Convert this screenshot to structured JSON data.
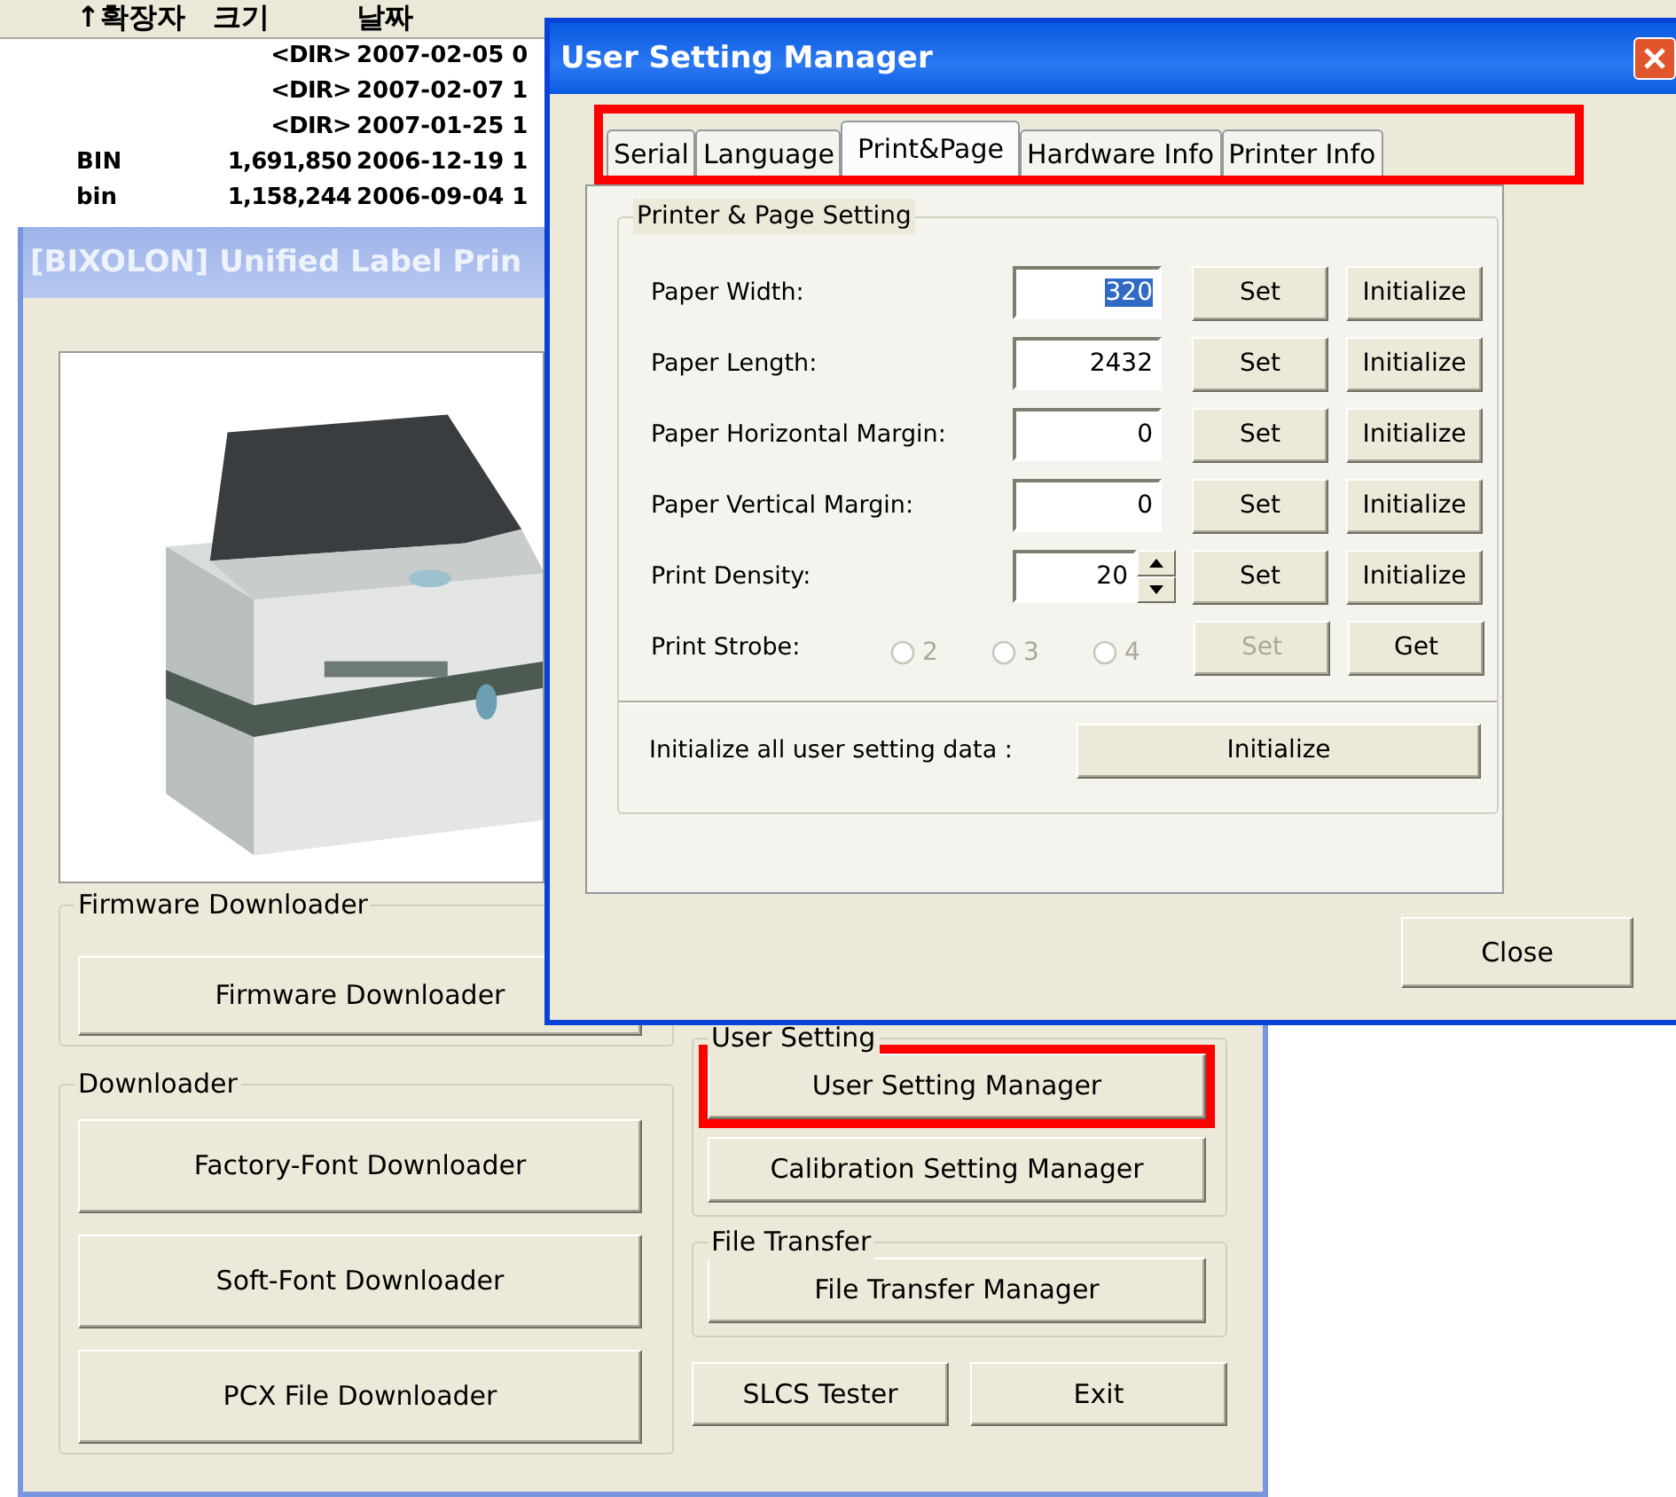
{
  "file_list": {
    "columns": [
      "↑확장자",
      "크기",
      "날짜"
    ],
    "rows": [
      {
        "size": "<DIR>",
        "date": "2007-02-05 0"
      },
      {
        "size": "<DIR>",
        "date": "2007-02-07 1"
      },
      {
        "size": "<DIR>",
        "date": "2007-01-25 1"
      },
      {
        "ext": "BIN",
        "size": "1,691,850",
        "date": "2006-12-19 1"
      },
      {
        "ext": "bin",
        "size": "1,158,244",
        "date": "2006-09-04 1"
      }
    ]
  },
  "main_window": {
    "title": "[BIXOLON] Unified Label Prin",
    "left_groups": [
      {
        "label": "Firmware Downloader",
        "buttons": [
          {
            "label": "Firmware Downloader",
            "highlighted": false
          }
        ]
      },
      {
        "label": "Downloader",
        "buttons": [
          {
            "label": "Factory-Font Downloader",
            "highlighted": false
          },
          {
            "label": "Soft-Font Downloader",
            "highlighted": false
          },
          {
            "label": "PCX File Downloader",
            "highlighted": false
          }
        ]
      }
    ],
    "right_groups": [
      {
        "label": "User Setting",
        "buttons": [
          {
            "label": "User Setting Manager",
            "highlighted": true
          },
          {
            "label": "Calibration Setting Manager",
            "highlighted": false
          }
        ]
      },
      {
        "label": "File Transfer",
        "buttons": [
          {
            "label": "File Transfer Manager",
            "highlighted": false
          }
        ]
      }
    ],
    "bottom_buttons": [
      "SLCS Tester",
      "Exit"
    ]
  },
  "dialog": {
    "title": "User Setting Manager",
    "tabs_highlighted": true,
    "tabs": [
      {
        "label": "Serial",
        "selected": false
      },
      {
        "label": "Language",
        "selected": false
      },
      {
        "label": "Print&Page",
        "selected": true
      },
      {
        "label": "Hardware Info",
        "selected": false
      },
      {
        "label": "Printer Info",
        "selected": false
      }
    ],
    "group_label": "Printer & Page Setting",
    "rows": [
      {
        "kind": "field",
        "label": "Paper Width:",
        "value": "320",
        "text_selected": true,
        "buttons": [
          {
            "label": "Set",
            "disabled": false
          },
          {
            "label": "Initialize",
            "disabled": false
          }
        ]
      },
      {
        "kind": "field",
        "label": "Paper Length:",
        "value": "2432",
        "text_selected": false,
        "buttons": [
          {
            "label": "Set",
            "disabled": false
          },
          {
            "label": "Initialize",
            "disabled": false
          }
        ]
      },
      {
        "kind": "field",
        "label": "Paper Horizontal Margin:",
        "value": "0",
        "text_selected": false,
        "buttons": [
          {
            "label": "Set",
            "disabled": false
          },
          {
            "label": "Initialize",
            "disabled": false
          }
        ]
      },
      {
        "kind": "field",
        "label": "Paper Vertical Margin:",
        "value": "0",
        "text_selected": false,
        "buttons": [
          {
            "label": "Set",
            "disabled": false
          },
          {
            "label": "Initialize",
            "disabled": false
          }
        ]
      },
      {
        "kind": "spinner",
        "label": "Print Density:",
        "value": "20",
        "text_selected": false,
        "buttons": [
          {
            "label": "Set",
            "disabled": false
          },
          {
            "label": "Initialize",
            "disabled": false
          }
        ]
      },
      {
        "kind": "radios",
        "label": "Print Strobe:",
        "options": [
          {
            "label": "2",
            "selected": false,
            "disabled": true
          },
          {
            "label": "3",
            "selected": false,
            "disabled": true
          },
          {
            "label": "4",
            "selected": false,
            "disabled": true
          }
        ],
        "buttons": [
          {
            "label": "Set",
            "disabled": true
          },
          {
            "label": "Get",
            "disabled": false
          }
        ]
      }
    ],
    "init_all": {
      "label": "Initialize all user setting data :",
      "button": "Initialize"
    },
    "close_button": "Close"
  }
}
